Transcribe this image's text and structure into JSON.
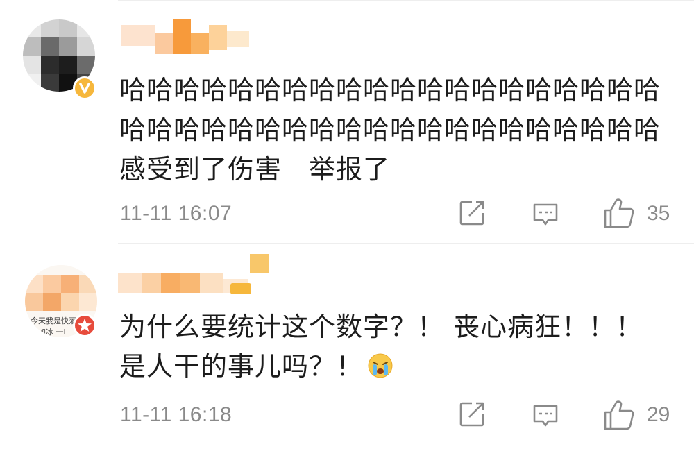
{
  "comments": [
    {
      "text": "哈哈哈哈哈哈哈哈哈哈哈哈哈哈哈哈哈哈哈哈哈哈哈哈哈哈哈哈哈哈哈哈哈哈哈哈哈哈哈哈感受到了伤害　举报了",
      "time": "11-11 16:07",
      "likes": "35",
      "badge": "verified-v-icon",
      "badge_color": "#f6b73c"
    },
    {
      "text": "为什么要统计这个数字？！ 丧心病狂！！！是人干的事儿吗？！",
      "emoji": "crying-emoji-icon",
      "time": "11-11 16:18",
      "likes": "29",
      "badge": "star-icon",
      "badge_color": "#e74b3c",
      "avatar_caption_1": "今天我是快落",
      "avatar_caption_2": "乐加冰 一L"
    }
  ],
  "icons": {
    "forward": "forward-icon",
    "reply": "reply-icon",
    "like": "thumbs-up-icon"
  },
  "colors": {
    "text": "#1c1c1c",
    "meta": "#8a8a8a",
    "divider": "#eeeeee",
    "redaction": "#f79a3b"
  }
}
